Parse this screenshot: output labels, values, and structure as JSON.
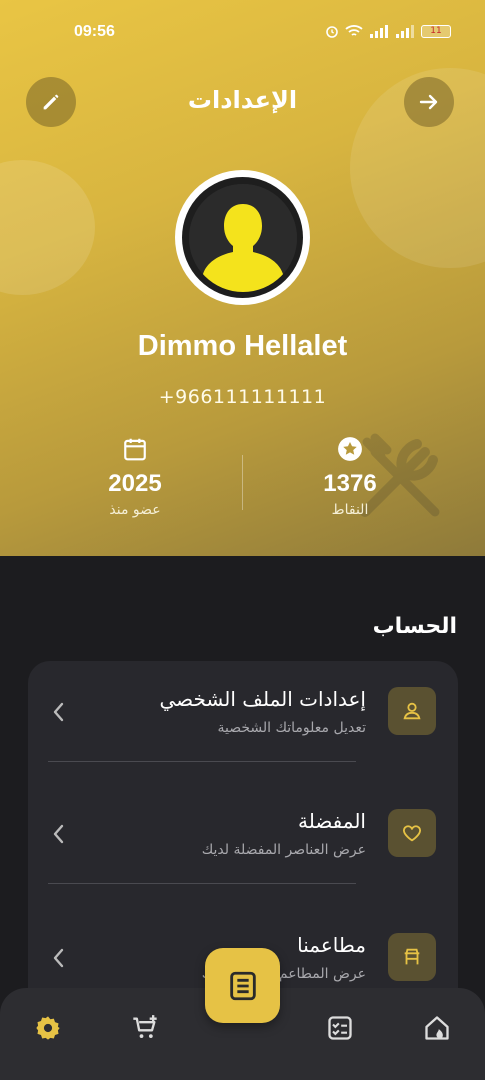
{
  "status_bar": {
    "time": "09:56",
    "battery": "11"
  },
  "header": {
    "title": "الإعدادات",
    "user_name": "Dimmo Hellalet",
    "phone": "+966111111111",
    "stats": {
      "points": {
        "value": "1376",
        "label": "النقاط",
        "icon": "star-circle-icon"
      },
      "member_since": {
        "value": "2025",
        "label": "عضو منذ",
        "icon": "calendar-icon"
      }
    }
  },
  "account": {
    "section_title": "الحساب",
    "items": [
      {
        "title": "إعدادات الملف الشخصي",
        "subtitle": "تعديل معلوماتك الشخصية",
        "icon": "person-icon"
      },
      {
        "title": "المفضلة",
        "subtitle": "عرض العناصر المفضلة لديك",
        "icon": "heart-icon"
      },
      {
        "title": "مطاعمنا",
        "subtitle": "عرض المطاعم المتاحة لديك",
        "icon": "restaurant-icon"
      }
    ]
  },
  "bottom_nav": {
    "items": [
      "settings-icon",
      "add-cart-icon",
      "menu-icon",
      "orders-icon",
      "home-fire-icon"
    ],
    "active": "settings-icon"
  },
  "colors": {
    "accent": "#e6c245",
    "background": "#1c1c1f",
    "card": "#28282d"
  }
}
